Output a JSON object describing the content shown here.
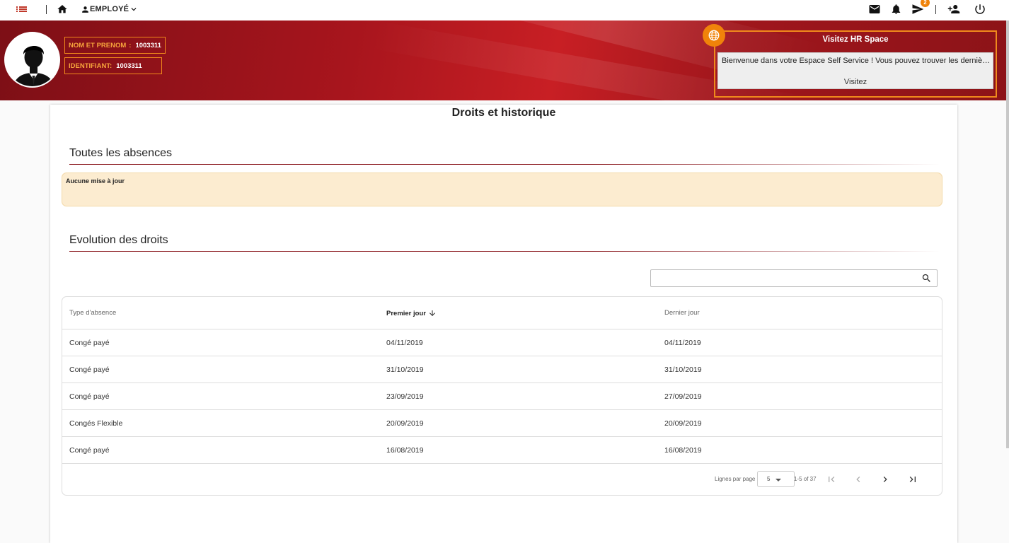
{
  "topbar": {
    "role_label": "EMPLOYÉ",
    "notifications_count": "2"
  },
  "banner": {
    "name_label": "NOM ET PRENOM",
    "name_value": "1003311",
    "id_label": "IDENTIFIANT:",
    "id_value": "1003311",
    "hr_title": "Visitez HR Space",
    "hr_message": "Bienvenue dans votre Espace Self Service ! Vous pouvez trouver les dernières informations",
    "hr_link": "Visitez"
  },
  "main": {
    "page_title": "Droits et historique",
    "section1_title": "Toutes les absences",
    "notice_text": "Aucune mise à jour",
    "section2_title": "Evolution des droits",
    "search_placeholder": ""
  },
  "table": {
    "columns": [
      "Type d'absence",
      "Premier jour",
      "Dernier jour"
    ],
    "rows": [
      [
        "Congé payé",
        "04/11/2019",
        "04/11/2019"
      ],
      [
        "Congé payé",
        "31/10/2019",
        "31/10/2019"
      ],
      [
        "Congé payé",
        "23/09/2019",
        "27/09/2019"
      ],
      [
        "Congés Flexible",
        "20/09/2019",
        "20/09/2019"
      ],
      [
        "Congé payé",
        "16/08/2019",
        "16/08/2019"
      ]
    ]
  },
  "pager": {
    "rows_per_page_label": "Lignes par page",
    "rows_per_page_value": "5",
    "range_label": "1-5 of 37"
  },
  "colors": {
    "brand_red": "#a8151d",
    "accent_orange": "#f0830a",
    "notice_bg": "#fcecd0"
  }
}
